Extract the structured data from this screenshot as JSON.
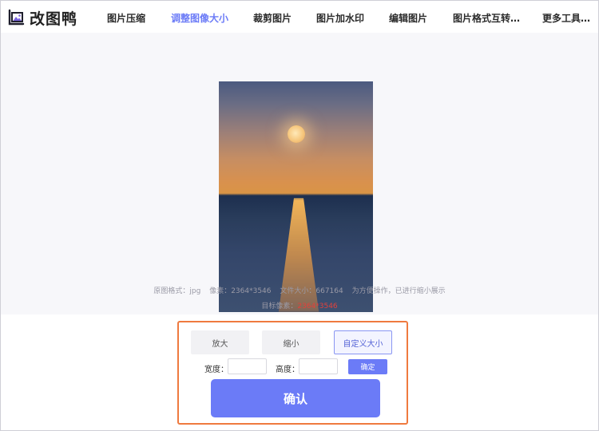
{
  "app": {
    "name": "改图鸭"
  },
  "nav": {
    "items": [
      {
        "label": "图片压缩",
        "active": false
      },
      {
        "label": "调整图像大小",
        "active": true
      },
      {
        "label": "裁剪图片",
        "active": false
      },
      {
        "label": "图片加水印",
        "active": false
      },
      {
        "label": "编辑图片",
        "active": false
      },
      {
        "label": "图片格式互转…",
        "active": false
      },
      {
        "label": "更多工具…",
        "active": false
      }
    ]
  },
  "preview": {
    "format_label": "原图格式：jpg",
    "pixels_label": "像素：2364*3546",
    "filesize_label": "文件大小：667164",
    "note": "为方便操作，已进行缩小展示",
    "target_label": "目标像素：",
    "target_value": "2364*3546"
  },
  "controls": {
    "options": [
      {
        "label": "放大",
        "selected": false
      },
      {
        "label": "缩小",
        "selected": false
      },
      {
        "label": "自定义大小",
        "selected": true
      }
    ],
    "width_label": "宽度：",
    "width_value": "",
    "height_label": "高度：",
    "height_value": "",
    "set_button": "确定",
    "confirm_button": "确认"
  },
  "colors": {
    "accent": "#6b7bf7",
    "panel_border": "#ef7a3f",
    "target_value": "#e2413b"
  }
}
